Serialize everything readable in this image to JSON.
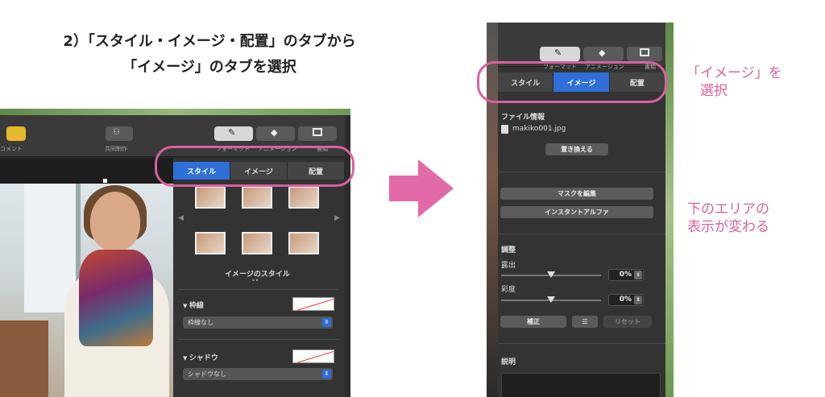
{
  "heading": {
    "line1": "2）「スタイル・イメージ・配置」のタブから",
    "line2": "「イメージ」のタブを選択"
  },
  "left_app": {
    "toolbar": {
      "comment_label": "コメント",
      "collab_label": "共同制作",
      "format_label": "フォーマット",
      "animation_label": "アニメーション",
      "document_label": "書類"
    },
    "tabs": [
      {
        "label": "スタイル",
        "active": true
      },
      {
        "label": "イメージ",
        "active": false
      },
      {
        "label": "配置",
        "active": false
      }
    ],
    "style_caption": "イメージのスタイル",
    "border": {
      "label": "枠線",
      "select_value": "枠線なし"
    },
    "shadow": {
      "label": "シャドウ",
      "select_value": "シャドウなし"
    }
  },
  "right_app": {
    "toolbar": {
      "format_label": "フォーマット",
      "animation_label": "アニメーション",
      "document_label": "書類"
    },
    "tabs": [
      {
        "label": "スタイル",
        "active": false
      },
      {
        "label": "イメージ",
        "active": true
      },
      {
        "label": "配置",
        "active": false
      }
    ],
    "file_info_title": "ファイル情報",
    "file_name": "makiko001.jpg",
    "replace_button": "置き換える",
    "edit_mask_button": "マスクを編集",
    "instant_alpha_button": "インスタントアルファ",
    "adjust_title": "調整",
    "exposure": {
      "label": "露出",
      "value": "0%",
      "level": 0.5
    },
    "saturation": {
      "label": "彩度",
      "value": "0%",
      "level": 0.5
    },
    "enhance_button": "補正",
    "reset_button": "リセット",
    "description_title": "説明"
  },
  "notes": {
    "select_image_line1": "「イメージ」を",
    "select_image_line2": "選択",
    "area_change_line1": "下のエリアの",
    "area_change_line2": "表示が変わる"
  },
  "colors": {
    "accent_blue": "#2e6fd8",
    "highlight_pink": "#d9609e",
    "arrow_pink": "#e26aa8"
  }
}
